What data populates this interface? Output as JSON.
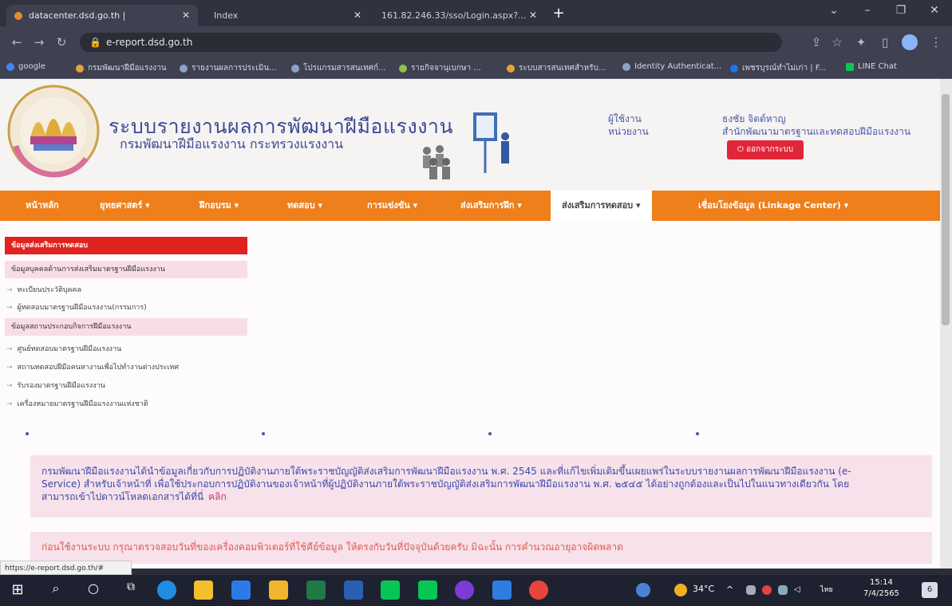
{
  "browser": {
    "tabs": [
      {
        "title": "datacenter.dsd.go.th |"
      },
      {
        "title": "Index"
      },
      {
        "title": "161.82.246.33/sso/Login.aspx?..."
      }
    ],
    "url": "e-report.dsd.go.th",
    "bookmarks": [
      "google",
      "กรมพัฒนาฝีมือแรงงาน",
      "รายงานผลการประเมิน...",
      "โปรแกรมสารสนเทศก์...",
      "รายกิจจานุเบกษา ...",
      "ระบบสารสนเทศสำหรับ...",
      "Identity Authenticat...",
      "เพชรบุรณ์ทำไม่เก่า | F...",
      "LINE Chat"
    ],
    "status_url": "https://e-report.dsd.go.th/#"
  },
  "header": {
    "system_title": "ระบบรายงานผลการพัฒนาฝีมือแรงงาน",
    "dept_title": "กรมพัฒนาฝีมือแรงงาน กระทรวงแรงงาน",
    "user_label": "ผู้ใช้งาน",
    "unit_label": "หน่วยงาน",
    "user_name": "ธงชัย จิตต์หาญ",
    "unit_name": "สำนักพัฒนามาตรฐานและทดสอบฝีมือแรงงาน",
    "logout": "ออกจากระบบ"
  },
  "nav": [
    "หน้าหลัก",
    "ยุทธศาสตร์ ▾",
    "ฝึกอบรม ▾",
    "ทดสอบ ▾",
    "การแข่งขัน ▾",
    "ส่งเสริมการฝึก ▾",
    "ส่งเสริมการทดสอบ ▾",
    "เชื่อมโยงข้อมูล (Linkage Center) ▾"
  ],
  "sidemenu": {
    "title": "ข้อมูลส่งเสริมการทดสอบ",
    "sections": [
      {
        "label": "ข้อมูลบุคคลด้านการส่งเสริมมาตรฐานฝีมือแรงงาน",
        "items": [
          "ทะเบียนประวัติบุคคล",
          "ผู้ทดสอบมาตรฐานฝีมือแรงงาน(กรรมการ)"
        ]
      },
      {
        "label": "ข้อมูลสถานประกอบกิจการฝีมือแรงงาน",
        "items": [
          "ศูนย์ทดสอบมาตรฐานฝีมือแรงงาน",
          "สถานทดสอบฝีมือคนหางานเพื่อไปทำงานต่างประเทศ",
          "รับรองมาตรฐานฝีมือแรงงาน",
          "เครื่องหมายมาตรฐานฝีมือแรงงานแห่งชาติ"
        ]
      }
    ]
  },
  "notice": {
    "line1": "กรมพัฒนาฝีมือแรงงานได้นำข้อมูลเกี่ยวกับการปฏิบัติงานภายใต้พระราชบัญญัติส่งเสริมการพัฒนาฝีมือแรงงาน พ.ศ. 2545 และที่แก้ไขเพิ่มเติมขึ้นเผยแพร่ในระบบรายงานผลการพัฒนาฝีมือแรงงาน (e-",
    "line2": "Service) สำหรับเจ้าหน้าที่ เพื่อใช้ประกอบการปฏิบัติงานของเจ้าหน้าที่ผู้ปฏิบัติงานภายใต้พระราชบัญญัติส่งเสริมการพัฒนาฝีมือแรงงาน พ.ศ. ๒๕๔๕ ได้อย่างถูกต้องและเป็นไปในแนวทางเดียวกัน โดย",
    "line3": "สามารถเข้าไปดาวน์โหลดเอกสารได้ที่นี่",
    "link": "คลิก",
    "warning": "ก่อนใช้งานระบบ กรุณาตรวจสอบวันที่ของเครื่องคอมพิวเตอร์ที่ใช้คีย์ข้อมูล ให้ตรงกับวันที่ปัจจุบันด้วยครับ มิฉะนั้น การคำนวณอายุอาจผิดพลาด"
  },
  "taskbar": {
    "temperature": "34°C",
    "lang": "ไทย",
    "time": "15:14",
    "date": "7/4/2565",
    "notif": "6"
  }
}
